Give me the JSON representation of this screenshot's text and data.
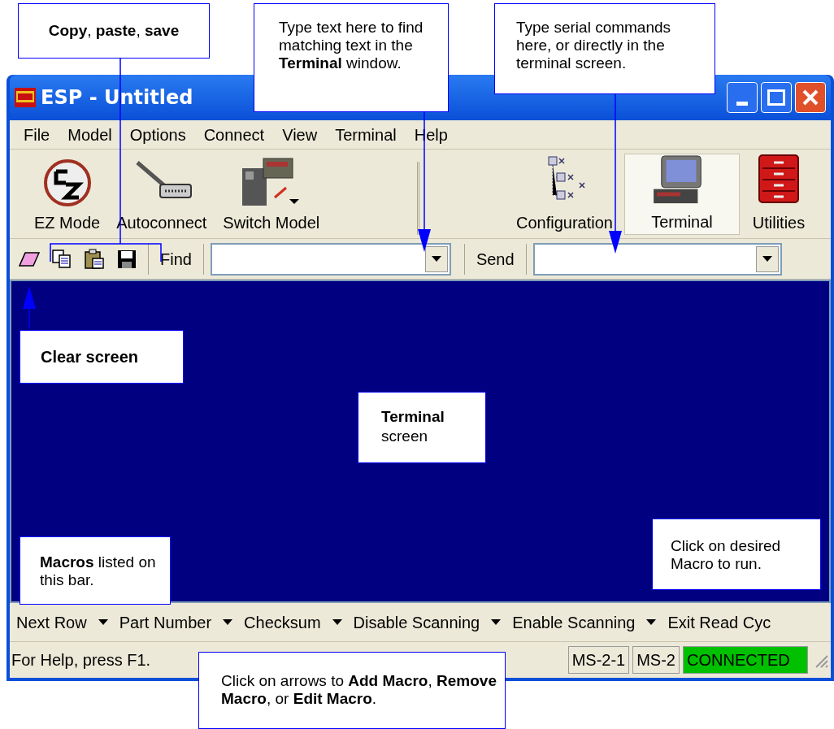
{
  "window": {
    "title": "ESP - Untitled"
  },
  "menu": [
    "File",
    "Model",
    "Options",
    "Connect",
    "View",
    "Terminal",
    "Help"
  ],
  "toolbar": [
    {
      "kind": "ez",
      "label": "EZ Mode",
      "selected": false
    },
    {
      "kind": "cable",
      "label": "Autoconnect",
      "selected": false
    },
    {
      "kind": "switch",
      "label": "Switch Model",
      "selected": false
    },
    {
      "kind": "separator"
    },
    {
      "kind": "config",
      "label": "Configuration",
      "selected": false
    },
    {
      "kind": "terminal",
      "label": "Terminal",
      "selected": true
    },
    {
      "kind": "utilities",
      "label": "Utilities",
      "selected": false
    }
  ],
  "find_bar": {
    "find_label": "Find",
    "send_label": "Send"
  },
  "macros": [
    "Next Row",
    "Part Number",
    "Checksum",
    "Disable Scanning",
    "Enable Scanning",
    "Exit Read Cyc"
  ],
  "status_bar": {
    "help": "For Help, press F1.",
    "panels": [
      "MS-2-1",
      "MS-2"
    ],
    "connection": "CONNECTED"
  },
  "callouts": [
    {
      "kind": "copy",
      "text": "**Copy**, **paste**, **save**"
    },
    {
      "kind": "find",
      "text": "Type text here to find matching text in the **Terminal** window."
    },
    {
      "kind": "send",
      "text": "Type serial commands here, or directly in the terminal screen."
    },
    {
      "kind": "clear",
      "text": "**Clear screen**"
    },
    {
      "kind": "terminal",
      "text": "**Terminal** screen"
    },
    {
      "kind": "macro-run",
      "text": "Click on desired Macro to run."
    },
    {
      "kind": "macros",
      "text": "**Macros** listed on this bar."
    },
    {
      "kind": "arrows",
      "text": "Click on arrows to **Add Macro**, **Remove Macro**, or **Edit Macro**."
    }
  ]
}
